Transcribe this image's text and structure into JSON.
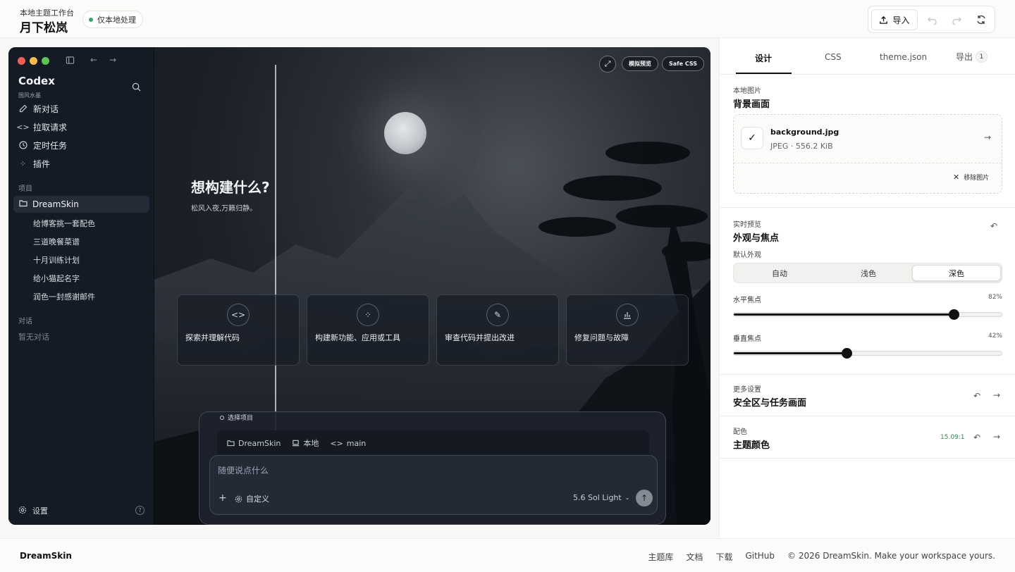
{
  "header": {
    "subtitle": "本地主题工作台",
    "title": "月下松岚",
    "local_badge": "仅本地处理",
    "import_label": "导入"
  },
  "preview": {
    "app_title": "Codex",
    "app_subtitle": "国风水墨",
    "nav": [
      {
        "label": "新对话",
        "icon": "pencil-icon"
      },
      {
        "label": "拉取请求",
        "icon": "code-icon"
      },
      {
        "label": "定时任务",
        "icon": "clock-icon"
      },
      {
        "label": "插件",
        "icon": "plugin-icon"
      }
    ],
    "projects_label": "项目",
    "project_name": "DreamSkin",
    "project_items": [
      "给博客挑一套配色",
      "三道晚餐菜谱",
      "十月训练计划",
      "给小猫起名字",
      "润色一封感谢邮件"
    ],
    "conversations_label": "对话",
    "no_conversations": "暂无对话",
    "settings_label": "设置",
    "help_label": "?",
    "pill_preview": "模拟预览",
    "pill_css": "Safe CSS",
    "hero_title": "想构建什么?",
    "hero_subtitle": "松风入夜,万籁归静。",
    "cards": [
      {
        "label": "探索并理解代码",
        "icon": "code-icon"
      },
      {
        "label": "构建新功能、应用或工具",
        "icon": "loader-icon"
      },
      {
        "label": "审查代码并提出改进",
        "icon": "pen-icon"
      },
      {
        "label": "修复问题与故障",
        "icon": "chart-icon"
      }
    ],
    "choose_project": "选择项目",
    "ctx_project": "DreamSkin",
    "ctx_env": "本地",
    "ctx_branch": "main",
    "composer_placeholder": "随便说点什么",
    "custom_label": "自定义",
    "model_label": "5.6 Sol Light"
  },
  "panel": {
    "tabs": [
      "设计",
      "CSS",
      "theme.json",
      "导出"
    ],
    "export_count": "1",
    "bg_section_label": "本地图片",
    "bg_section_title": "背景画面",
    "file_name": "background.jpg",
    "file_meta": "JPEG · 556.2 KiB",
    "remove_label": "移除图片",
    "live_label": "实时预览",
    "live_title": "外观与焦点",
    "appearance_label": "默认外观",
    "appearance_options": [
      "自动",
      "浅色",
      "深色"
    ],
    "appearance_selected": "深色",
    "h_focus_label": "水平焦点",
    "h_focus_value": "82%",
    "h_focus": 0.82,
    "v_focus_label": "垂直焦点",
    "v_focus_value": "42%",
    "v_focus": 0.42,
    "more_label": "更多设置",
    "more_title": "安全区与任务画面",
    "color_label": "配色",
    "color_title": "主题颜色",
    "contrast": "15.09:1"
  },
  "footer": {
    "brand": "DreamSkin",
    "links": [
      "主题库",
      "文档",
      "下载",
      "GitHub"
    ],
    "copyright": "© 2026 DreamSkin. Make your workspace yours."
  },
  "colors": {
    "accent": "#111111",
    "status_green": "#3aa56b",
    "contrast_green": "#2f8a54"
  }
}
